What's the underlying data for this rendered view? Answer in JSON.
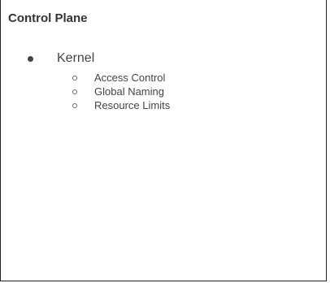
{
  "panel": {
    "title": "Control Plane"
  },
  "outline": {
    "items": [
      {
        "label": "Kernel",
        "children": [
          {
            "label": "Access Control"
          },
          {
            "label": "Global Naming"
          },
          {
            "label": "Resource Limits"
          }
        ]
      }
    ]
  },
  "colors": {
    "text": "#333333",
    "border": "#222222",
    "background": "#ffffff"
  },
  "icons": {
    "level1_bullet": "filled-circle-bullet-icon",
    "level2_bullet": "hollow-circle-bullet-icon"
  }
}
